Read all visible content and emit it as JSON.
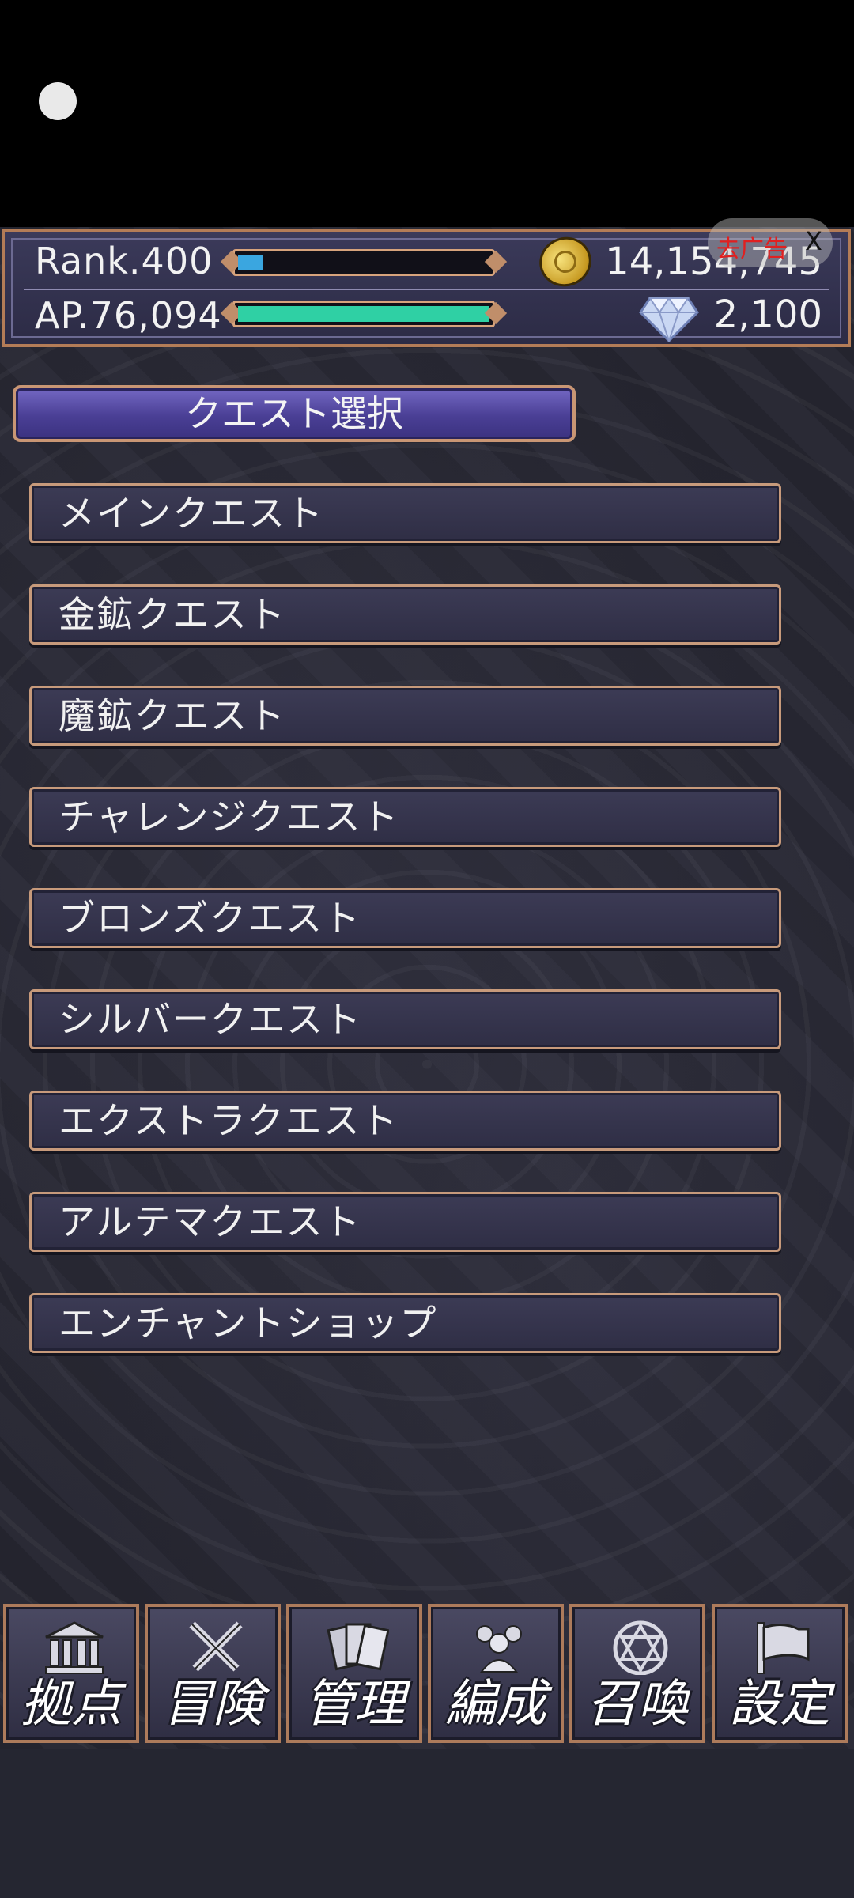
{
  "header": {
    "rank_label": "Rank.400",
    "rank_progress": 0.1,
    "ap_label": "AP.76,094",
    "ap_progress": 1.0,
    "gold_value": "14,154,745",
    "gem_value": "2,100"
  },
  "ad": {
    "label": "去广告",
    "close": "X"
  },
  "title": "クエスト選択",
  "quests": [
    "メインクエスト",
    "金鉱クエスト",
    "魔鉱クエスト",
    "チャレンジクエスト",
    "ブロンズクエスト",
    "シルバークエスト",
    "エクストラクエスト",
    "アルテマクエスト",
    "エンチャントショップ"
  ],
  "nav": [
    {
      "label": "拠点",
      "icon": "base-building-icon"
    },
    {
      "label": "冒険",
      "icon": "crossed-swords-icon"
    },
    {
      "label": "管理",
      "icon": "cards-icon"
    },
    {
      "label": "編成",
      "icon": "party-group-icon"
    },
    {
      "label": "召喚",
      "icon": "hexagram-icon"
    },
    {
      "label": "設定",
      "icon": "flag-settings-icon"
    }
  ],
  "colors": {
    "rank_bar": "#3aa6e0",
    "ap_bar": "#2fd0a4",
    "frame": "#c79a7b",
    "title_bg": "#4a3f95"
  }
}
